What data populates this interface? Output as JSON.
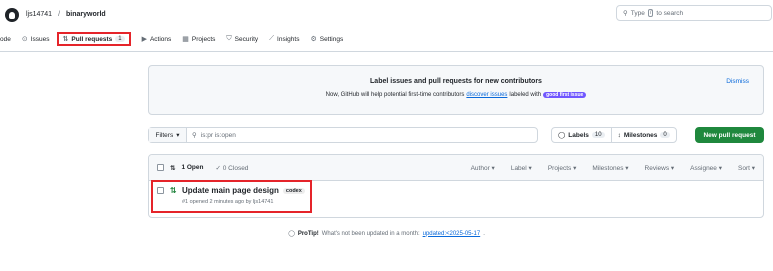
{
  "header": {
    "owner": "ljs14741",
    "separator": "/",
    "repo": "binaryworld",
    "search_prefix": "Type",
    "search_key": "/",
    "search_suffix": "to search"
  },
  "tabs": [
    {
      "label": "ode",
      "icon": "‹›"
    },
    {
      "label": "Issues",
      "icon": "⊙"
    },
    {
      "label": "Pull requests",
      "icon": "⇅",
      "count": "1"
    },
    {
      "label": "Actions",
      "icon": "▶"
    },
    {
      "label": "Projects",
      "icon": "▦"
    },
    {
      "label": "Security",
      "icon": "⛉"
    },
    {
      "label": "Insights",
      "icon": "⟋"
    },
    {
      "label": "Settings",
      "icon": "⚙"
    }
  ],
  "banner": {
    "title": "Label issues and pull requests for new contributors",
    "sub_prefix": "Now, GitHub will help potential first-time contributors",
    "sub_link": "discover issues",
    "sub_suffix": "labeled with",
    "label": "good first issue",
    "dismiss": "Dismiss"
  },
  "filterbar": {
    "filters_label": "Filters",
    "query": "is:pr is:open",
    "labels_label": "Labels",
    "labels_count": "10",
    "milestones_label": "Milestones",
    "milestones_count": "0",
    "new_pr": "New pull request"
  },
  "list": {
    "open_label": "1 Open",
    "closed_label": "0 Closed",
    "columns": [
      "Author",
      "Label",
      "Projects",
      "Milestones",
      "Reviews",
      "Assignee",
      "Sort"
    ],
    "items": [
      {
        "title": "Update main page design",
        "label": "codex",
        "meta": "#1 opened 2 minutes ago by ljs14741"
      }
    ]
  },
  "protip": {
    "strong": "ProTip!",
    "text": "What's not been updated in a month:",
    "link": "updated:<2025-05-17",
    "end": "."
  },
  "colors": {
    "accent_link": "#0969da",
    "primary_button": "#1f883d",
    "highlight_box": "#e5242a",
    "good_first_issue": "#7057ff"
  }
}
